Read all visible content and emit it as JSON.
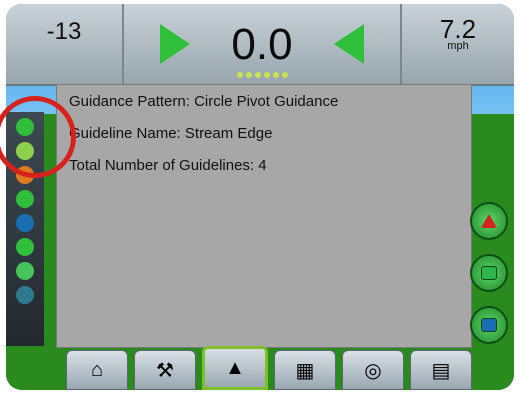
{
  "top": {
    "left_value": "-13",
    "center_value": "0.0",
    "right_value": "7.2",
    "right_unit": "mph"
  },
  "overlay": {
    "guidance_pattern": "Guidance Pattern: Circle Pivot Guidance",
    "guideline_name": "Guideline Name: Stream Edge",
    "total_guidelines": "Total Number of Guidelines: 4"
  },
  "left_strip": {
    "icons": [
      "guidance-pattern-icon",
      "guideline-icon",
      "marker-icon",
      "vehicle-icon",
      "compass-icon",
      "tilt-icon",
      "green-drop-icon",
      "boom-icon"
    ]
  },
  "right_buttons": {
    "icons": [
      "nav-arrow-icon",
      "map-icon",
      "screen-icon"
    ]
  },
  "bottom_tabs": [
    {
      "name": "home-tab",
      "icon": "house-icon"
    },
    {
      "name": "tools-tab",
      "icon": "wrench-icon"
    },
    {
      "name": "guidance-tab",
      "icon": "guidance-icon"
    },
    {
      "name": "map-tab",
      "icon": "map-icon"
    },
    {
      "name": "camera-tab",
      "icon": "camera-icon"
    },
    {
      "name": "system-tab",
      "icon": "stack-icon"
    }
  ],
  "colors": {
    "accent_green": "#2fbf3b",
    "overlay_bg": "#a7a7a7",
    "highlight_ring": "#d5221d"
  }
}
